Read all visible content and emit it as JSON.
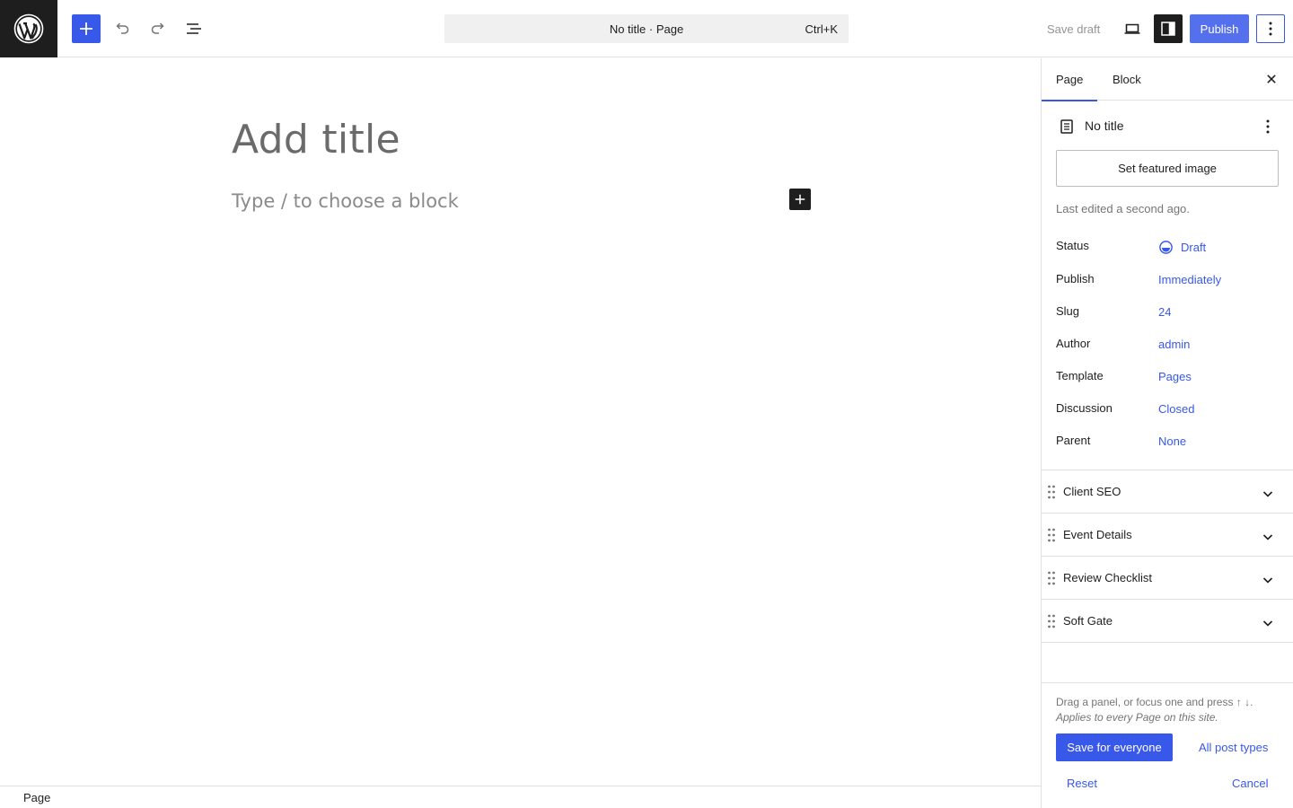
{
  "topbar": {
    "command_title": "No title · Page",
    "command_shortcut": "Ctrl+K",
    "save_draft": "Save draft",
    "publish": "Publish"
  },
  "canvas": {
    "title_placeholder": "Add title",
    "block_placeholder": "Type / to choose a block"
  },
  "footer": {
    "breadcrumb": "Page"
  },
  "sidebar": {
    "tabs": [
      {
        "label": "Page"
      },
      {
        "label": "Block"
      }
    ],
    "post_title": "No title",
    "featured_image_button": "Set featured image",
    "last_edited": "Last edited a second ago.",
    "properties": [
      {
        "label": "Status",
        "value": "Draft"
      },
      {
        "label": "Publish",
        "value": "Immediately"
      },
      {
        "label": "Slug",
        "value": "24"
      },
      {
        "label": "Author",
        "value": "admin"
      },
      {
        "label": "Template",
        "value": "Pages"
      },
      {
        "label": "Discussion",
        "value": "Closed"
      },
      {
        "label": "Parent",
        "value": "None"
      }
    ],
    "panels": [
      {
        "title": "Client SEO"
      },
      {
        "title": "Event Details"
      },
      {
        "title": "Review Checklist"
      },
      {
        "title": "Soft Gate"
      }
    ],
    "footer": {
      "hint": "Drag a panel, or focus one and press ↑ ↓.",
      "scope_note": "Applies to every Page on this site.",
      "save_for_everyone": "Save for everyone",
      "all_post_types": "All post types",
      "reset": "Reset",
      "cancel": "Cancel"
    }
  },
  "colors": {
    "accent": "#3858e9",
    "dark": "#1e1e1e",
    "border": "#e0e0e0",
    "muted": "#757575"
  }
}
